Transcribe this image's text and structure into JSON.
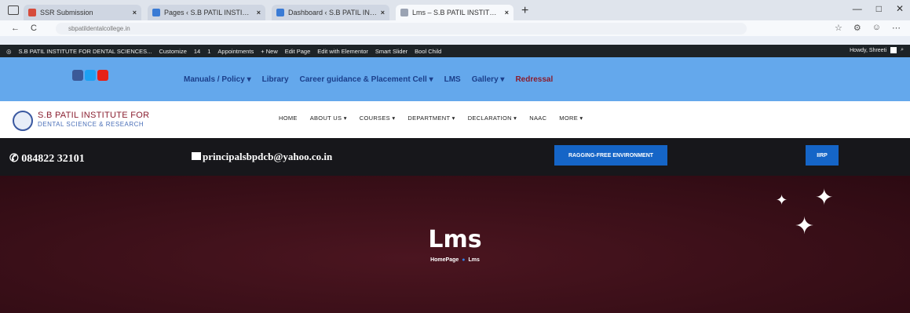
{
  "browser": {
    "tabs": [
      {
        "title": "SSR Submission",
        "color": "#d64c3c",
        "active": false
      },
      {
        "title": "Pages ‹ S.B PATIL INSTITUTE FOR",
        "color": "#3a7bd5",
        "active": false
      },
      {
        "title": "Dashboard ‹ S.B PATIL INSTITUT",
        "color": "#3a7bd5",
        "active": false
      },
      {
        "title": "Lms – S.B PATIL INSTITUTE FOR",
        "color": "#9aa3b3",
        "active": true
      }
    ],
    "new_tab": "+",
    "url": "sbpatildentalcollege.in",
    "window_controls": [
      "—",
      "□",
      "✕"
    ]
  },
  "admin_bar": {
    "site": "S.B PATIL INSTITUTE FOR DENTAL SCIENCES...",
    "items": [
      "Customize",
      "14",
      "1",
      "Appointments",
      "+ New",
      "Edit Page",
      "Edit with Elementor",
      "Smart Slider",
      "Bool Child"
    ],
    "howdy": "Howdy, Shreeti"
  },
  "top_menu": {
    "items": [
      "Manuals / Policy ▾",
      "Library",
      "Career guidance & Placement Cell ▾",
      "LMS",
      "Gallery ▾"
    ],
    "redressal": "Redressal",
    "social": [
      "facebook-icon",
      "twitter-icon",
      "youtube-icon"
    ]
  },
  "logo": {
    "line1": "S.B PATIL INSTITUTE FOR",
    "line2": "DENTAL SCIENCE & RESEARCH"
  },
  "main_nav": [
    "HOME",
    "ABOUT US ▾",
    "COURSES ▾",
    "DEPARTMENT ▾",
    "DECLARATION ▾",
    "NAAC",
    "MORE ▾"
  ],
  "contact": {
    "phone": "084822 32101",
    "email": "principalsbpdcb@yahoo.co.in",
    "ragging_button": "RAGGING-FREE ENVIRONMENT",
    "other_button": "IIRP"
  },
  "hero": {
    "title": "Lms",
    "breadcrumb_home": "HomePage",
    "breadcrumb_current": "Lms"
  },
  "colors": {
    "topbar": "#64a8ec",
    "admin_bar": "#1d2327",
    "contact_bar": "#17171b",
    "hero": "#3a0f18",
    "button": "#1565c7"
  }
}
